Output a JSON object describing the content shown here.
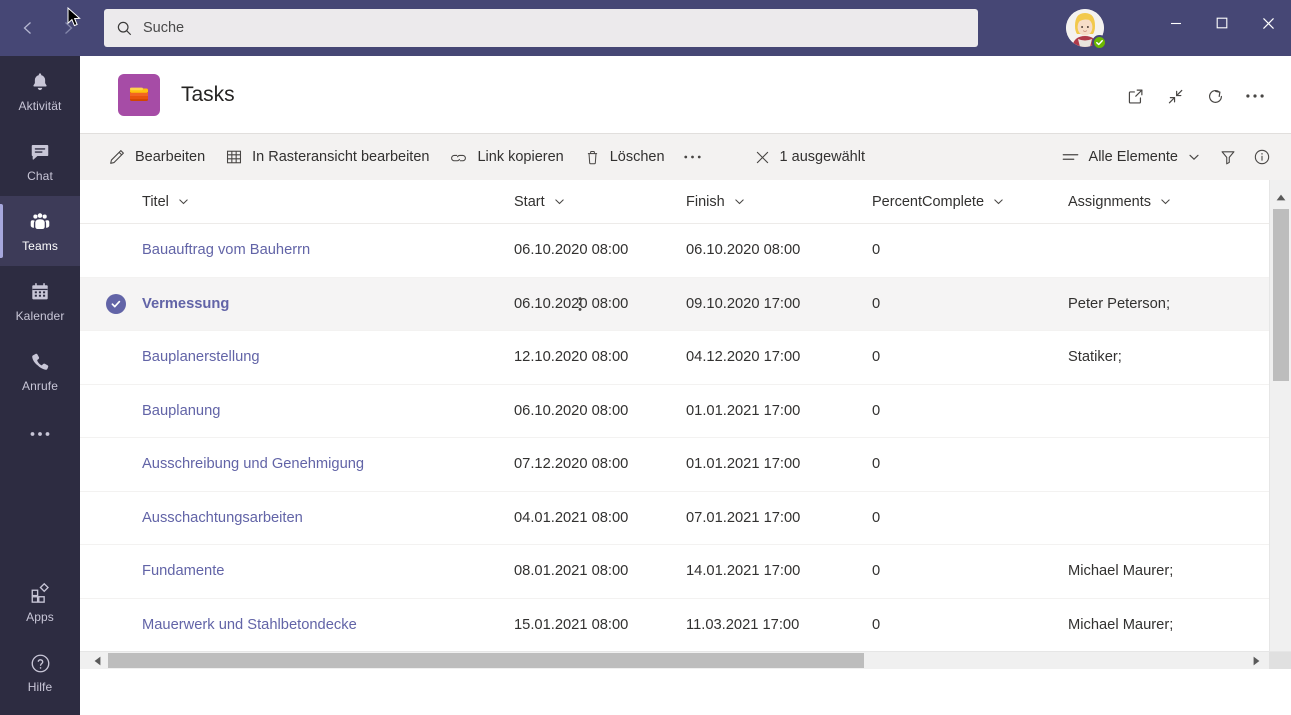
{
  "titlebar": {
    "back_label": "Zurück",
    "forward_label": "Vor",
    "search": {
      "placeholder": "Suche",
      "value": ""
    },
    "avatar_alt": "Profilbild",
    "presence_status": "Verfügbar",
    "minimize_label": "Minimieren",
    "maximize_label": "Maximieren",
    "close_label": "Schließen"
  },
  "rail": {
    "items": [
      {
        "label": "Aktivität",
        "icon": "bell-icon",
        "active": false
      },
      {
        "label": "Chat",
        "icon": "chat-icon",
        "active": false
      },
      {
        "label": "Teams",
        "icon": "teams-icon",
        "active": true
      },
      {
        "label": "Kalender",
        "icon": "calendar-icon",
        "active": false
      },
      {
        "label": "Anrufe",
        "icon": "phone-icon",
        "active": false
      }
    ],
    "more_label": "Weitere Apps",
    "bottom_items": [
      {
        "label": "Apps",
        "icon": "apps-icon"
      },
      {
        "label": "Hilfe",
        "icon": "help-icon"
      }
    ]
  },
  "header": {
    "title": "Tasks",
    "app_icon": "sharepoint-list-icon",
    "actions": [
      {
        "name": "open-in-browser-icon",
        "label": "In Browser öffnen"
      },
      {
        "name": "collapse-icon",
        "label": "Reduzieren"
      },
      {
        "name": "refresh-icon",
        "label": "Aktualisieren"
      },
      {
        "name": "more-options-icon",
        "label": "Weitere Optionen"
      }
    ]
  },
  "commandbar": {
    "edit_label": "Bearbeiten",
    "grid_edit_label": "In Rasteransicht bearbeiten",
    "copy_link_label": "Link kopieren",
    "delete_label": "Löschen",
    "overflow_label": "…",
    "selection_label": "1 ausgewählt",
    "view_label": "Alle Elemente",
    "filter_label": "Filter",
    "info_label": "Informationen"
  },
  "table": {
    "columns": [
      {
        "key": "title",
        "label": "Titel"
      },
      {
        "key": "start",
        "label": "Start"
      },
      {
        "key": "finish",
        "label": "Finish"
      },
      {
        "key": "percent",
        "label": "PercentComplete"
      },
      {
        "key": "assignments",
        "label": "Assignments"
      }
    ],
    "rows": [
      {
        "title": "Bauauftrag vom Bauherrn",
        "start": "06.10.2020 08:00",
        "finish": "06.10.2020 08:00",
        "percent": "0",
        "assignments": "",
        "selected": false
      },
      {
        "title": "Vermessung",
        "start": "06.10.2020 08:00",
        "finish": "09.10.2020 17:00",
        "percent": "0",
        "assignments": "Peter Peterson;",
        "selected": true
      },
      {
        "title": "Bauplanerstellung",
        "start": "12.10.2020 08:00",
        "finish": "04.12.2020 17:00",
        "percent": "0",
        "assignments": "Statiker;",
        "selected": false
      },
      {
        "title": "Bauplanung",
        "start": "06.10.2020 08:00",
        "finish": "01.01.2021 17:00",
        "percent": "0",
        "assignments": "",
        "selected": false
      },
      {
        "title": "Ausschreibung und Genehmigung",
        "start": "07.12.2020 08:00",
        "finish": "01.01.2021 17:00",
        "percent": "0",
        "assignments": "",
        "selected": false
      },
      {
        "title": "Ausschachtungsarbeiten",
        "start": "04.01.2021 08:00",
        "finish": "07.01.2021 17:00",
        "percent": "0",
        "assignments": "",
        "selected": false
      },
      {
        "title": "Fundamente",
        "start": "08.01.2021 08:00",
        "finish": "14.01.2021 17:00",
        "percent": "0",
        "assignments": "Michael Maurer;",
        "selected": false
      },
      {
        "title": "Mauerwerk und Stahlbetondecke",
        "start": "15.01.2021 08:00",
        "finish": "11.03.2021 17:00",
        "percent": "0",
        "assignments": "Michael Maurer;",
        "selected": false
      }
    ]
  },
  "colors": {
    "titlebar": "#464775",
    "rail": "#2d2c41",
    "rail_active": "#3d3b58",
    "accent": "#6264a7",
    "command_bar": "#f3f2f1",
    "app_icon": "#a64ca6",
    "presence_green": "#6bb700"
  }
}
